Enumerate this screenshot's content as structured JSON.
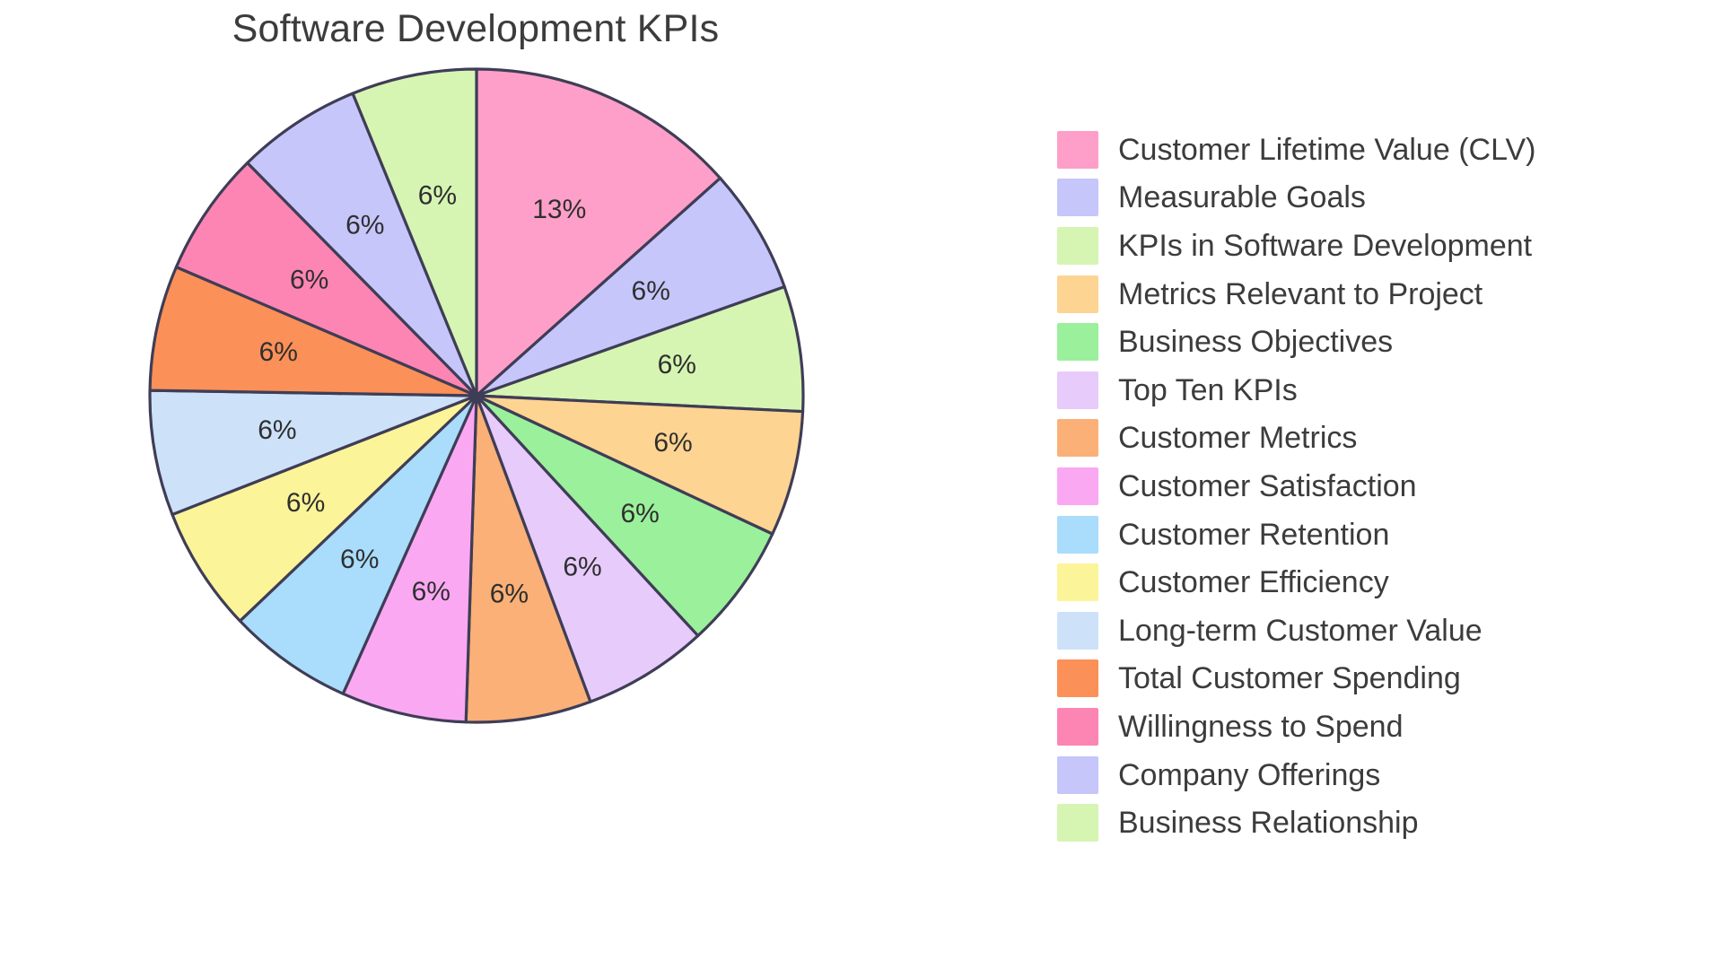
{
  "chart_data": {
    "type": "pie",
    "title": "Software Development KPIs",
    "labels": [
      "Customer Lifetime Value (CLV)",
      "Measurable Goals",
      "KPIs in Software Development",
      "Metrics Relevant to Project",
      "Business Objectives",
      "Top Ten KPIs",
      "Customer Metrics",
      "Customer Satisfaction",
      "Customer Retention",
      "Customer Efficiency",
      "Long-term Customer Value",
      "Total Customer Spending",
      "Willingness to Spend",
      "Company Offerings",
      "Business Relationship"
    ],
    "values": [
      13,
      6,
      6,
      6,
      6,
      6,
      6,
      6,
      6,
      6,
      6,
      6,
      6,
      6,
      6
    ],
    "value_labels": [
      "13%",
      "6%",
      "6%",
      "6%",
      "6%",
      "6%",
      "6%",
      "6%",
      "6%",
      "6%",
      "6%",
      "6%",
      "6%",
      "6%",
      "6%"
    ],
    "colors": [
      "#fd9fc8",
      "#c6c6fb",
      "#d6f5b3",
      "#fdd492",
      "#9bf09b",
      "#e7cbfb",
      "#fbb077",
      "#fba8f3",
      "#aadcfb",
      "#fcf499",
      "#cde2f9",
      "#fb9058",
      "#fd85b4",
      "#c6c6fb",
      "#d6f5b3"
    ],
    "start_angle_deg": 0,
    "direction": "clockwise",
    "slice_border_color": "#3f3d56",
    "label_text_color": "#2f2f2f",
    "title_color": "#3c3c3c",
    "legend_position": "right",
    "background": "#ffffff"
  },
  "legend": {
    "items": [
      {
        "label": "Customer Lifetime Value (CLV)",
        "color": "#fd9fc8"
      },
      {
        "label": "Measurable Goals",
        "color": "#c6c6fb"
      },
      {
        "label": "KPIs in Software Development",
        "color": "#d6f5b3"
      },
      {
        "label": "Metrics Relevant to Project",
        "color": "#fdd492"
      },
      {
        "label": "Business Objectives",
        "color": "#9bf09b"
      },
      {
        "label": "Top Ten KPIs",
        "color": "#e7cbfb"
      },
      {
        "label": "Customer Metrics",
        "color": "#fbb077"
      },
      {
        "label": "Customer Satisfaction",
        "color": "#fba8f3"
      },
      {
        "label": "Customer Retention",
        "color": "#aadcfb"
      },
      {
        "label": "Customer Efficiency",
        "color": "#fcf499"
      },
      {
        "label": "Long-term Customer Value",
        "color": "#cde2f9"
      },
      {
        "label": "Total Customer Spending",
        "color": "#fb9058"
      },
      {
        "label": "Willingness to Spend",
        "color": "#fd85b4"
      },
      {
        "label": "Company Offerings",
        "color": "#c6c6fb"
      },
      {
        "label": "Business Relationship",
        "color": "#d6f5b3"
      }
    ]
  }
}
